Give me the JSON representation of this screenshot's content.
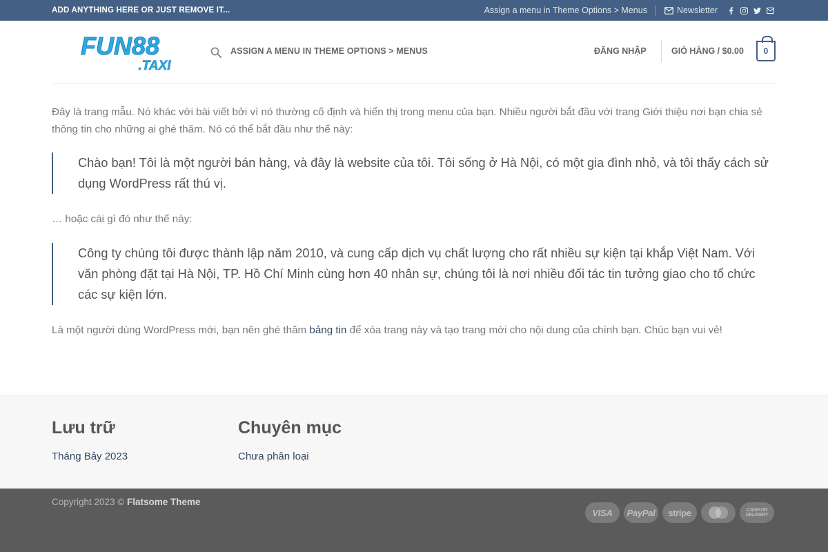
{
  "topbar": {
    "left_text": "ADD ANYTHING HERE OR JUST REMOVE IT...",
    "menu_hint": "Assign a menu in Theme Options > Menus",
    "newsletter": "Newsletter",
    "social_icons": [
      "facebook-icon",
      "instagram-icon",
      "twitter-icon",
      "email-icon"
    ]
  },
  "header": {
    "logo": {
      "main": "FUN88",
      "sub": ".TAXI"
    },
    "main_menu": "ASSIGN A MENU IN THEME OPTIONS > MENUS",
    "login": "ĐĂNG NHẬP",
    "cart_label": "GIỎ HÀNG /",
    "cart_price": "$0.00",
    "cart_count": "0"
  },
  "content": {
    "p1": "Đây là trang mẫu. Nó khác với bài viết bởi vì nó thường cố định và hiển thị trong menu của bạn. Nhiều người bắt đầu với trang Giới thiệu nơi bạn chia sẻ thông tin cho những ai ghé thăm. Nó có thể bắt đầu như thế này:",
    "quote1": "Chào bạn! Tôi là một người bán hàng, và đây là website của tôi. Tôi sống ở Hà Nội, có một gia đình nhỏ, và tôi thấy cách sử dụng WordPress rất thú vị.",
    "p2": "… hoặc cái gì đó như thế này:",
    "quote2": "Công ty chúng tôi được thành lập năm 2010, và cung cấp dịch vụ chất lượng cho rất nhiều sự kiện tại khắp Việt Nam. Với văn phòng đặt tại Hà Nội, TP. Hồ Chí Minh cùng hơn 40 nhân sự, chúng tôi là nơi nhiều đối tác tin tưởng giao cho tổ chức các sự kiện lớn.",
    "p3_before": "Là một người dùng WordPress mới, bạn nên ghé thăm ",
    "p3_link": "bảng tin",
    "p3_after": " để xóa trang này và tạo trang mới cho nội dung của chính bạn. Chúc bạn vui vẻ!"
  },
  "widgets": [
    {
      "title": "Lưu trữ",
      "link": "Tháng Bảy 2023"
    },
    {
      "title": "Chuyên mục",
      "link": "Chưa phân loại"
    }
  ],
  "footer": {
    "copyright_prefix": "Copyright 2023 ©",
    "theme_name": "Flatsome Theme",
    "payments": [
      "VISA",
      "PayPal",
      "stripe",
      "MasterCard",
      "CASH ON DELIVERY"
    ]
  },
  "colors": {
    "primary": "#446084",
    "link": "#334862",
    "logo_blue": "#2fa8e0",
    "footer_bg": "#5b5b5b"
  }
}
